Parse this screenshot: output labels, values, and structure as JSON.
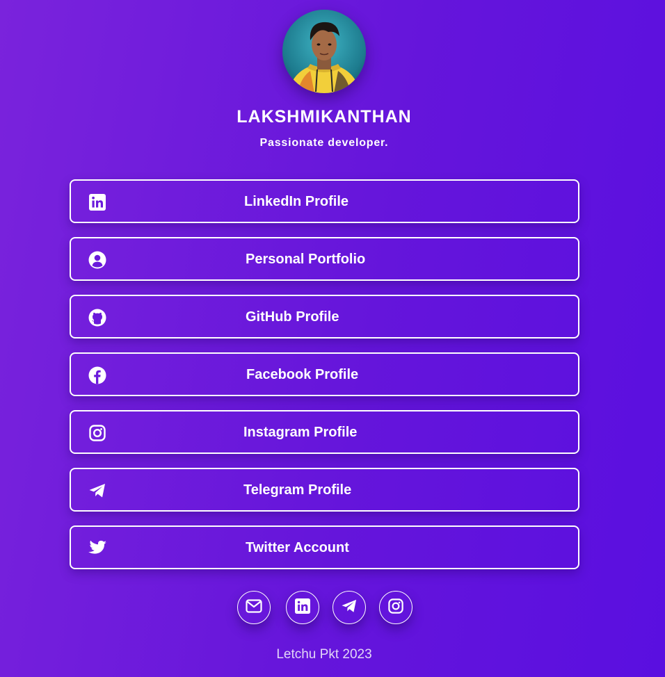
{
  "profile": {
    "name": "LAKSHMIKANTHAN",
    "bio": "Passionate developer."
  },
  "links": [
    {
      "label": "LinkedIn Profile",
      "icon": "linkedin-icon"
    },
    {
      "label": "Personal Portfolio",
      "icon": "user-circle-icon"
    },
    {
      "label": "GitHub Profile",
      "icon": "github-icon"
    },
    {
      "label": "Facebook Profile",
      "icon": "facebook-icon"
    },
    {
      "label": "Instagram Profile",
      "icon": "instagram-icon"
    },
    {
      "label": "Telegram Profile",
      "icon": "telegram-icon"
    },
    {
      "label": "Twitter Account",
      "icon": "twitter-icon"
    }
  ],
  "socials": [
    {
      "icon": "mail-icon"
    },
    {
      "icon": "linkedin-icon"
    },
    {
      "icon": "telegram-icon"
    },
    {
      "icon": "instagram-icon"
    }
  ],
  "footer": {
    "text": "Letchu Pkt 2023"
  },
  "colors": {
    "background_start": "#7a23dc",
    "background_end": "#5a0fe0",
    "foreground": "#ffffff"
  }
}
